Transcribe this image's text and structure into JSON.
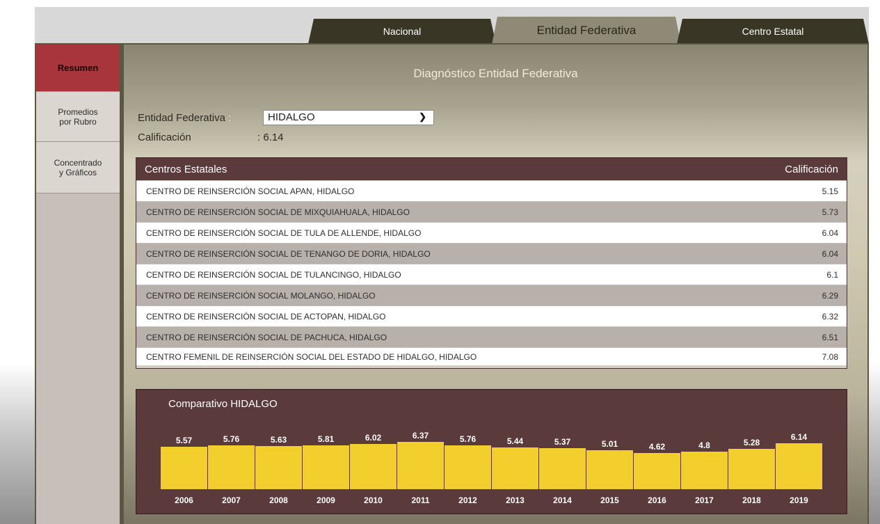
{
  "tabs": [
    {
      "label": "Nacional"
    },
    {
      "label": "Entidad Federativa"
    },
    {
      "label": "Centro Estatal"
    }
  ],
  "sidebar": {
    "items": [
      {
        "label": "Resumen"
      },
      {
        "label": "Promedios\npor Rubro"
      },
      {
        "label": "Concentrado\ny Gráficos"
      }
    ]
  },
  "main": {
    "title": "Diagnóstico Entidad Federativa",
    "entidad_label": "Entidad Federativa",
    "entidad_colon": " : ",
    "entidad_value": "HIDALGO",
    "calificacion_label": "Calificación",
    "calificacion_value": ": 6.14"
  },
  "table": {
    "header_centros": "Centros Estatales",
    "header_calificacion": "Calificación",
    "rows": [
      {
        "name": "CENTRO DE REINSERCIÓN SOCIAL APAN, HIDALGO",
        "score": "5.15"
      },
      {
        "name": "CENTRO DE REINSERCIÓN SOCIAL DE MIXQUIAHUALA, HIDALGO",
        "score": "5.73"
      },
      {
        "name": "CENTRO DE REINSERCIÓN SOCIAL DE TULA DE ALLENDE, HIDALGO",
        "score": "6.04"
      },
      {
        "name": "CENTRO DE REINSERCIÓN SOCIAL DE TENANGO DE DORIA, HIDALGO",
        "score": "6.04"
      },
      {
        "name": "CENTRO DE REINSERCIÓN SOCIAL DE TULANCINGO, HIDALGO",
        "score": "6.1"
      },
      {
        "name": "CENTRO DE REINSERCIÓN SOCIAL MOLANGO, HIDALGO",
        "score": "6.29"
      },
      {
        "name": "CENTRO DE REINSERCIÓN SOCIAL DE ACTOPAN, HIDALGO",
        "score": "6.32"
      },
      {
        "name": "CENTRO DE REINSERCIÓN SOCIAL DE PACHUCA, HIDALGO",
        "score": "6.51"
      },
      {
        "name": "CENTRO FEMENIL DE REINSERCIÓN SOCIAL DEL ESTADO DE HIDALGO, HIDALGO",
        "score": "7.08"
      }
    ]
  },
  "chart_data": {
    "type": "bar",
    "title": "Comparativo HIDALGO",
    "categories": [
      "2006",
      "2007",
      "2008",
      "2009",
      "2010",
      "2011",
      "2012",
      "2013",
      "2014",
      "2015",
      "2016",
      "2017",
      "2018",
      "2019"
    ],
    "values": [
      5.57,
      5.76,
      5.63,
      5.81,
      6.02,
      6.37,
      5.76,
      5.44,
      5.37,
      5.01,
      4.62,
      4.8,
      5.28,
      6.14
    ],
    "labels": [
      "5.57",
      "5.76",
      "5.63",
      "5.81",
      "6.02",
      "6.37",
      "5.76",
      "5.44",
      "5.37",
      "5.01",
      "4.62",
      "4.8",
      "5.28",
      "6.14"
    ],
    "bar_color": "#f2cf2d"
  },
  "colors": {
    "active_sidebar": "#a8343c",
    "header_bg": "#5a3a3a",
    "tab_dark": "#3a3626"
  }
}
